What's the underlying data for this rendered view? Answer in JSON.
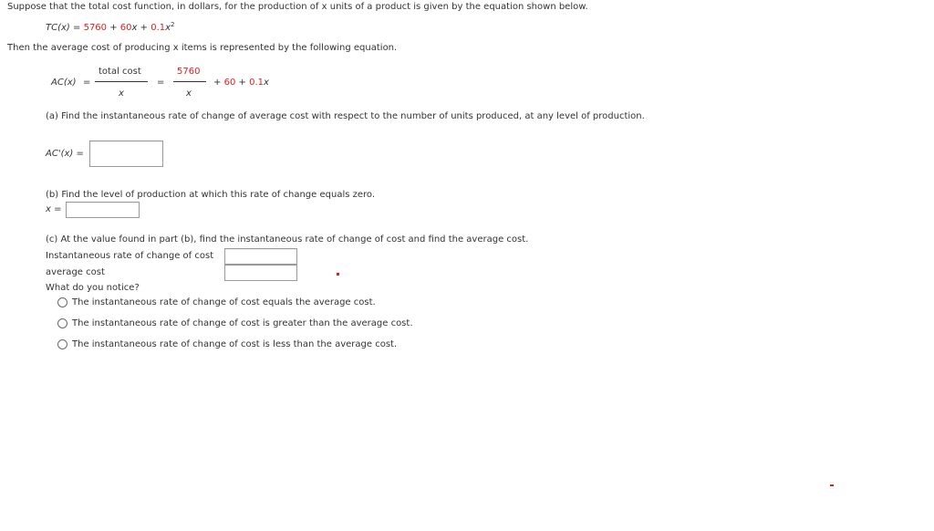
{
  "intro": {
    "text": "Suppose that the total cost function, in dollars, for the production of x units of a product is given by the equation shown below."
  },
  "tc_equation": {
    "lhs": "TC(x)",
    "equals": "=",
    "const": "5760",
    "plus1": "+",
    "coef1": "60",
    "var1": "x",
    "plus2": "+",
    "coef2": "0.1",
    "var2": "x",
    "exp": "2"
  },
  "avg_intro": {
    "text": "Then the average cost of producing x items is represented by the following equation."
  },
  "ac_equation": {
    "lhs": "AC(x)",
    "equals": "=",
    "frac1_num": "total cost",
    "frac1_den": "x",
    "equals2": "=",
    "frac2_num": "5760",
    "frac2_den": "x",
    "plus1": "+",
    "term1": "60",
    "plus2": "+",
    "term2_coef": "0.1",
    "term2_var": "x"
  },
  "part_a": {
    "question": "(a) Find the instantaneous rate of change of average cost with respect to the number of units produced, at any level of production.",
    "label": "AC'(x)",
    "equals": "=",
    "answer": ""
  },
  "part_b": {
    "question": "(b) Find the level of production at which this rate of change equals zero.",
    "label": "x",
    "equals": "=",
    "answer": ""
  },
  "part_c": {
    "question": "(c) At the value found in part (b), find the instantaneous rate of change of cost and find the average cost.",
    "rate_label": "Instantaneous rate of change of cost",
    "rate_answer": "",
    "avg_label": "average cost",
    "avg_answer": "",
    "notice_label": "What do you notice?",
    "options": [
      "The instantaneous rate of change of cost equals the average cost.",
      "The instantaneous rate of change of cost is greater than the average cost.",
      "The instantaneous rate of change of cost is less than the average cost."
    ]
  },
  "colors": {
    "highlight": "#e01e1e",
    "text": "#333333"
  }
}
